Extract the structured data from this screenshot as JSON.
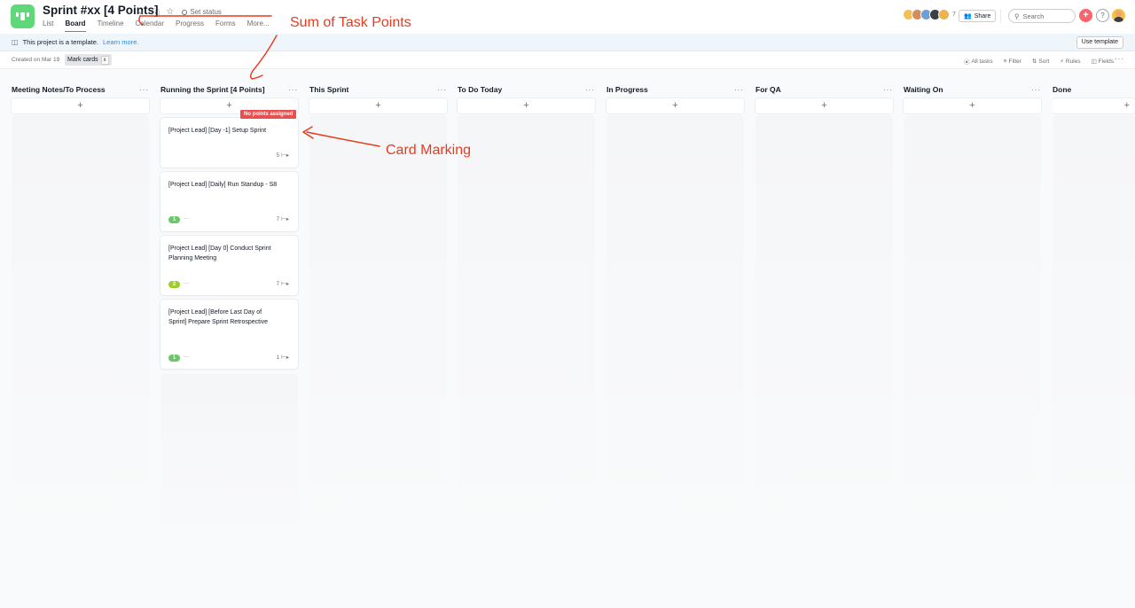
{
  "header": {
    "project_title": "Sprint #xx [4 Points]",
    "set_status": "Set status",
    "tabs": [
      {
        "label": "List",
        "active": false
      },
      {
        "label": "Board",
        "active": true
      },
      {
        "label": "Timeline",
        "active": false
      },
      {
        "label": "Calendar",
        "active": false
      },
      {
        "label": "Progress",
        "active": false
      },
      {
        "label": "Forms",
        "active": false
      },
      {
        "label": "More...",
        "active": false
      }
    ],
    "member_count": "7",
    "share_label": "Share",
    "search_placeholder": "Search",
    "help_label": "?",
    "add_label": "+"
  },
  "colors": {
    "brand": "#5fd87a",
    "active_tab": "#3ea55c",
    "annotation": "#ea3a1e",
    "no_points_badge": "#e8504f",
    "badge_green": "#6cc76a",
    "badge_lime": "#9fcc2e",
    "link": "#2d8ad6"
  },
  "banner": {
    "text": "This project is a template.",
    "link": "Learn more.",
    "use_template": "Use template"
  },
  "toolbar": {
    "created_on": "Created on Mar 19",
    "mark_cards": "Mark cards",
    "mark_cards_close": "x",
    "all_tasks": "All tasks",
    "filter": "Filter",
    "sort": "Sort",
    "rules": "Rules",
    "fields": "Fields",
    "more": "···"
  },
  "columns": [
    {
      "title": "Meeting Notes/To Process"
    },
    {
      "title": "Running the Sprint [4 Points]"
    },
    {
      "title": "This Sprint"
    },
    {
      "title": "To Do Today"
    },
    {
      "title": "In Progress"
    },
    {
      "title": "For QA"
    },
    {
      "title": "Waiting On"
    },
    {
      "title": "Done"
    }
  ],
  "add_card_label": "+",
  "column_more_label": "···",
  "cards": [
    {
      "title": "[Project Lead] [Day -1] Setup Sprint",
      "subtasks": "5",
      "marker": "No points assigned",
      "badge": ""
    },
    {
      "title": "[Project Lead] [Daily] Run Standup - S8",
      "subtasks": "7",
      "marker": "",
      "badge": "1"
    },
    {
      "title": "[Project Lead] [Day 0] Conduct Sprint Planning Meeting",
      "subtasks": "7",
      "marker": "",
      "badge": "2"
    },
    {
      "title": "[Project Lead] [Before Last Day of Sprint] Prepare Sprint Retrospective",
      "subtasks": "1",
      "marker": "",
      "badge": "1"
    }
  ],
  "annotations": {
    "sum_points": "Sum of Task Points",
    "card_marking": "Card Marking"
  },
  "icons": [
    "chevron-down-icon",
    "info-icon",
    "star-icon",
    "status-circle-icon",
    "share-icon",
    "search-icon",
    "template-icon",
    "check-circle-icon",
    "filter-icon",
    "sort-icon",
    "rules-icon",
    "fields-icon",
    "subtask-icon",
    "more-icon"
  ]
}
